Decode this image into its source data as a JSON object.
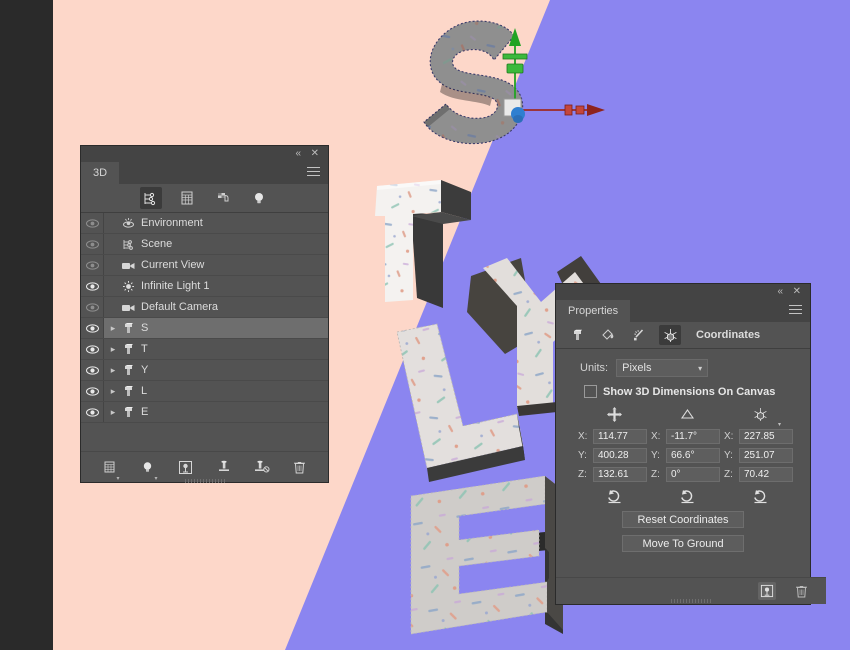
{
  "canvas": {
    "background_left_color": "#fdd7c9",
    "background_right_color": "#8b85f0",
    "app_chrome_color": "#2a2a2a",
    "letters": [
      {
        "name": "S",
        "selected": true,
        "top_color": "#8f8f8f",
        "side_color": "#5b5b5b"
      },
      {
        "name": "T",
        "selected": false,
        "top_color": "#f2f0ee",
        "side_color": "#444444"
      },
      {
        "name": "Y",
        "selected": false,
        "top_color": "#ddd9d6",
        "side_color": "#474443"
      },
      {
        "name": "L",
        "selected": false,
        "top_color": "#dedad8",
        "side_color": "#3a3a3a"
      },
      {
        "name": "E",
        "selected": false,
        "top_color": "#c9c6c3",
        "side_color": "#3d3b3a"
      }
    ],
    "gizmo": {
      "y_axis_color": "#22a324",
      "x_axis_color": "#9e2a22",
      "center_color": "#2f7fd0"
    }
  },
  "panel_3d": {
    "tab_label": "3D",
    "collapse_icon": "double-chevron-left-icon",
    "close_icon": "close-icon",
    "menu_icon": "panel-menu-icon",
    "mode_icons": [
      {
        "name": "scene-icon",
        "active": true
      },
      {
        "name": "mesh-icon",
        "active": false
      },
      {
        "name": "materials-icon",
        "active": false
      },
      {
        "name": "lights-icon",
        "active": false
      }
    ],
    "items": [
      {
        "label": "Environment",
        "icon": "environment-icon",
        "indent": 0,
        "expandable": false,
        "selected": false,
        "eye_on": false
      },
      {
        "label": "Scene",
        "icon": "scene-icon",
        "indent": 0,
        "expandable": false,
        "selected": false,
        "eye_on": false
      },
      {
        "label": "Current View",
        "icon": "camera-icon",
        "indent": 1,
        "expandable": false,
        "selected": false,
        "eye_on": false
      },
      {
        "label": "Infinite Light 1",
        "icon": "light-icon",
        "indent": 1,
        "expandable": false,
        "selected": false,
        "eye_on": true
      },
      {
        "label": "Default Camera",
        "icon": "camera-icon",
        "indent": 1,
        "expandable": false,
        "selected": false,
        "eye_on": false
      },
      {
        "label": "S",
        "icon": "mesh-icon",
        "indent": 1,
        "expandable": true,
        "selected": true,
        "eye_on": true
      },
      {
        "label": "T",
        "icon": "mesh-icon",
        "indent": 1,
        "expandable": true,
        "selected": false,
        "eye_on": true
      },
      {
        "label": "Y",
        "icon": "mesh-icon",
        "indent": 1,
        "expandable": true,
        "selected": false,
        "eye_on": true
      },
      {
        "label": "L",
        "icon": "mesh-icon",
        "indent": 1,
        "expandable": true,
        "selected": false,
        "eye_on": true
      },
      {
        "label": "E",
        "icon": "mesh-icon",
        "indent": 1,
        "expandable": true,
        "selected": false,
        "eye_on": true
      }
    ],
    "footer_icons": [
      {
        "name": "add-mesh-icon"
      },
      {
        "name": "add-light-icon"
      },
      {
        "name": "render-icon"
      },
      {
        "name": "add-ground-plane-icon"
      },
      {
        "name": "remove-ground-plane-icon"
      },
      {
        "name": "delete-icon"
      }
    ]
  },
  "panel_properties": {
    "tab_label": "Properties",
    "collapse_icon": "double-chevron-left-icon",
    "close_icon": "close-icon",
    "menu_icon": "panel-menu-icon",
    "mode_icons": [
      {
        "name": "mesh-icon",
        "active": false
      },
      {
        "name": "materials-icon",
        "active": false
      },
      {
        "name": "sparkle-icon",
        "active": false
      },
      {
        "name": "coordinates-icon",
        "active": true
      }
    ],
    "section_title": "Coordinates",
    "units_label": "Units:",
    "units_value": "Pixels",
    "units_dropdown_icon": "chevron-down-icon",
    "show_dimensions_label": "Show 3D Dimensions On Canvas",
    "show_dimensions_checked": false,
    "column_icons": [
      {
        "name": "move-icon"
      },
      {
        "name": "rotate-icon"
      },
      {
        "name": "scale-icon"
      }
    ],
    "coordinates": {
      "position": {
        "x_label": "X:",
        "x": "114.77",
        "y_label": "Y:",
        "y": "400.28",
        "z_label": "Z:",
        "z": "132.61"
      },
      "rotation": {
        "x_label": "X:",
        "x": "-11.7°",
        "y_label": "Y:",
        "y": "66.6°",
        "z_label": "Z:",
        "z": "0°"
      },
      "scale": {
        "x_label": "X:",
        "x": "227.85",
        "y_label": "Y:",
        "y": "251.07",
        "z_label": "Z:",
        "z": "70.42"
      }
    },
    "reset_icons": [
      {
        "name": "reset-position-icon"
      },
      {
        "name": "reset-rotation-icon"
      },
      {
        "name": "reset-scale-icon"
      }
    ],
    "reset_coordinates_label": "Reset Coordinates",
    "move_to_ground_label": "Move To Ground",
    "footer_icons": [
      {
        "name": "render-icon",
        "active": true
      },
      {
        "name": "delete-icon",
        "active": false
      }
    ]
  }
}
